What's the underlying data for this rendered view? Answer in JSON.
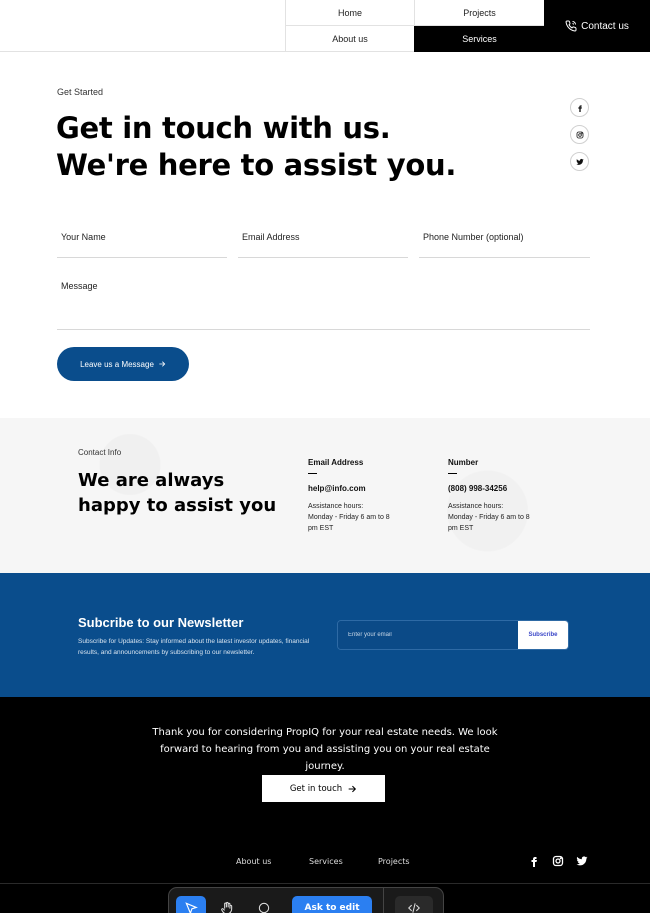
{
  "nav": {
    "home": "Home",
    "projects": "Projects",
    "about": "About us",
    "services": "Services",
    "contact": "Contact us"
  },
  "hero": {
    "eyebrow": "Get Started",
    "title_line1": "Get in touch with us.",
    "title_line2": "We're here to assist you."
  },
  "social_icons": [
    "facebook-icon",
    "instagram-icon",
    "twitter-icon"
  ],
  "form": {
    "name_placeholder": "Your Name",
    "email_placeholder": "Email Address",
    "phone_placeholder": "Phone Number (optional)",
    "message_placeholder": "Message",
    "submit_label": "Leave us a Message"
  },
  "contact_info": {
    "eyebrow": "Contact Info",
    "title_line1": "We are always",
    "title_line2": "happy to assist you",
    "email": {
      "label": "Email Address",
      "value": "help@info.com",
      "hours_label": "Assistance hours:",
      "hours": "Monday - Friday 6 am to 8 pm EST"
    },
    "number": {
      "label": "Number",
      "value": "(808) 998-34256",
      "hours_label": "Assistance hours:",
      "hours": "Monday - Friday 6 am to 8 pm EST"
    }
  },
  "newsletter": {
    "title": "Subcribe to our Newsletter",
    "description": "Subscribe for Updates: Stay informed about the latest investor updates, financial results, and announcements by subscribing to our newsletter.",
    "input_placeholder": "Enter your email",
    "button_label": "Subscribe"
  },
  "footer": {
    "message": "Thank you for considering PropIQ for your real estate needs. We look forward to hearing from you and assisting you on your real estate journey.",
    "cta_label": "Get in touch",
    "links": {
      "about": "About us",
      "services": "Services",
      "projects": "Projects"
    }
  },
  "toolbar": {
    "ask_label": "Ask to edit"
  },
  "colors": {
    "brand_blue": "#0a4d8c",
    "black": "#000000",
    "toolbar_accent": "#2b7ff1"
  }
}
